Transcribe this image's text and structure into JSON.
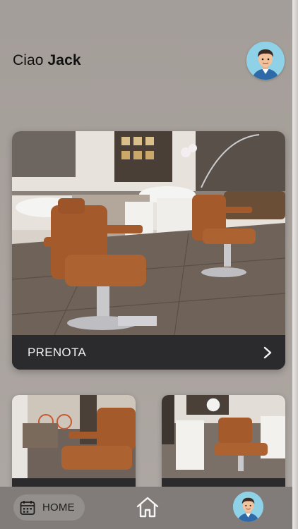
{
  "header": {
    "greeting": "Ciao",
    "user_name": "Jack",
    "avatar_icon": "user-avatar-icon"
  },
  "cards": {
    "main": {
      "label": "PRENOTA",
      "action_icon": "chevron-right-icon"
    },
    "secondary": [
      {
        "image": "barber-chair-photo"
      },
      {
        "image": "barber-shop-photo"
      }
    ]
  },
  "bottom_nav": {
    "home_label": "HOME",
    "home_icon": "calendar-icon",
    "center_icon": "house-icon",
    "profile_icon": "user-avatar-icon"
  },
  "colors": {
    "background": "#a8a19c",
    "card_bar": "#2b2b2e",
    "nav_bar": "#817c79",
    "chair_leather": "#a55a2c"
  }
}
